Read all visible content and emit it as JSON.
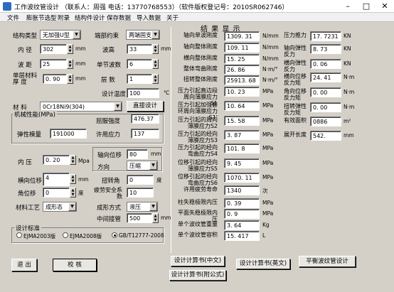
{
  "window": {
    "title": "工作波纹管设计  （联系人：周强 电话：13770768553）（软件版权登记号：2010SR062746）",
    "minimize": "–",
    "maximize": "□",
    "close": "✕"
  },
  "menu": [
    "文件",
    "膨胀节选型",
    "附录",
    "结构件设计",
    "保存数据",
    "导入数据",
    "关于"
  ],
  "left": {
    "structure_type_label": "结构类型",
    "structure_type": "无加强U型",
    "end_constraint_label": "端部约束",
    "end_constraint": "两端固支",
    "inner_dia_label": "内  径",
    "inner_dia": "302",
    "inner_dia_unit": "mm",
    "wave_height_label": "波高",
    "wave_height": "33",
    "wave_height_unit": "mm",
    "pitch_label": "波  距",
    "pitch": "25",
    "pitch_unit": "mm",
    "waves_label": "单节波数",
    "waves": "6",
    "ply_thk_label": "单层材料厚  度",
    "ply_thk": "0. 90",
    "ply_thk_unit": "mm",
    "plies_label": "层  数",
    "plies": "1",
    "design_temp_label": "设计温度",
    "design_temp": "100",
    "design_temp_unit": "℃",
    "material_label": "材  料",
    "material": "0Cr18Ni9(304)",
    "direct_design_btn": "直接设计",
    "mech_group": "机械性能(MPa)",
    "yield_label": "屈服强度",
    "yield": "476.37",
    "elastic_label": "弹性模量",
    "elastic": "191000",
    "allowable_label": "许用应力",
    "allowable": "137",
    "pressure_label": "内  压",
    "pressure": "0. 20",
    "pressure_unit": "Mpa",
    "axial_disp_label": "轴向位移",
    "axial_disp": "80",
    "axial_disp_unit": "mm",
    "direction_label": "方向",
    "direction": "压缩",
    "lateral_label": "横向位移",
    "lateral": "4",
    "lateral_unit": "mm",
    "torsion_label": "扭转角",
    "torsion": "0",
    "torsion_unit": "度",
    "angular_label": "角位移",
    "angular": "0",
    "angular_unit": "度",
    "fatigue_sf_label": "疲劳安全系  数",
    "fatigue_sf": "10",
    "process_label": "材料工艺",
    "process": "成形态",
    "forming_label": "成形方式",
    "forming": "液压",
    "mid_support_label": "中间接管",
    "mid_support": "500",
    "mid_support_unit": "mm",
    "std_group": "设计标准",
    "std1": "EJMA2003版",
    "std2": "EJMA2008版",
    "std3": "GB/T12777-2008"
  },
  "results": {
    "title": "结 果 显 示",
    "col1": [
      {
        "label": "轴向单波刚度",
        "value": "1309. 31",
        "unit": "N/mm"
      },
      {
        "label": "轴向整体刚度",
        "value": "109. 11",
        "unit": "N/mm"
      },
      {
        "label": "横向整体刚度",
        "value": "15. 25",
        "unit": "N/mm"
      },
      {
        "label": "整体弯曲刚度",
        "value": "26. 86",
        "unit": "N·m/°"
      },
      {
        "label": "扭转整体刚度",
        "value": "25913. 68",
        "unit": "N·m/°"
      },
      {
        "label": "压力引起直边段周向薄膜应力S1",
        "value": "10. 23",
        "unit": "MPa"
      },
      {
        "label": "压力引起加强套环周向薄膜应力S1'",
        "value": "10. 64",
        "unit": "MPa"
      },
      {
        "label": "压力引起的周向薄膜应力S2",
        "value": "15. 58",
        "unit": "MPa"
      },
      {
        "label": "压力引起的经向薄膜应力S3",
        "value": "3. 87",
        "unit": "MPa"
      },
      {
        "label": "压力引起的经向弯曲应力S4",
        "value": "101. 8",
        "unit": "MPa"
      },
      {
        "label": "位移引起的经向薄膜应力S5",
        "value": "9. 45",
        "unit": "MPa"
      },
      {
        "label": "位移引起的经向弯曲应力S6",
        "value": "1070. 11",
        "unit": "MPa"
      },
      {
        "label": "许用疲劳寿命",
        "value": "1340",
        "unit": "次"
      },
      {
        "label": "柱失稳极限内压",
        "value": "0. 39",
        "unit": "MPa"
      },
      {
        "label": "平面失稳极限内压",
        "value": "0. 9",
        "unit": "MPa"
      },
      {
        "label": "单个波纹管重量",
        "value": "3. 64",
        "unit": "Kg"
      },
      {
        "label": "单个波纹管容积",
        "value": "15. 417",
        "unit": "L"
      }
    ],
    "col2": [
      {
        "label": "压力推力",
        "value": "17. 7231",
        "unit": "KN"
      },
      {
        "label": "轴向弹性反力",
        "value": "8. 73",
        "unit": "KN"
      },
      {
        "label": "横向弹性反力",
        "value": "0. 06",
        "unit": "KN"
      },
      {
        "label": "横向位移反力矩",
        "value": "24. 41",
        "unit": "N·m"
      },
      {
        "label": "角向位移反力矩",
        "value": "0. 00",
        "unit": "N·m"
      },
      {
        "label": "扭转弹性反力矩",
        "value": "0. 00",
        "unit": "N·m"
      },
      {
        "label": "有效面积",
        "value": "0886",
        "unit": "m²"
      },
      {
        "label": "展开长度",
        "value": "542.",
        "unit": "mm"
      }
    ]
  },
  "buttons": {
    "exit": "退  出",
    "check": "校  核",
    "calc_cn": "设计计算书(中文)",
    "calc_en": "设计计算书(英文)",
    "calc_formula": "设计计算书(附公式)",
    "flat": "平衡波纹管设计"
  }
}
